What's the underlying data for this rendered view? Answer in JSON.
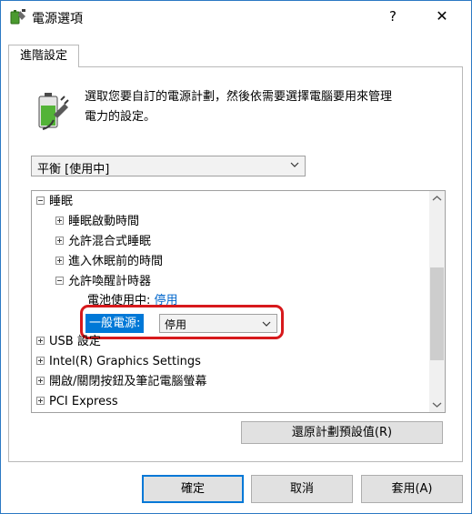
{
  "window": {
    "title": "電源選項",
    "help_label": "?",
    "close_label": "✕"
  },
  "tabs": [
    {
      "label": "進階設定",
      "selected": true
    }
  ],
  "description": {
    "line1": "選取您要自訂的電源計劃，然後依需要選擇電腦要用來管理",
    "line2": "電力的設定。"
  },
  "plan_select": {
    "value": "平衡 [使用中]"
  },
  "tree": {
    "items": [
      {
        "label": "睡眠",
        "expander": "minus"
      },
      {
        "label": "睡眠啟動時間",
        "expander": "plus"
      },
      {
        "label": "允許混合式睡眠",
        "expander": "plus"
      },
      {
        "label": "進入休眠前的時間",
        "expander": "plus"
      },
      {
        "label": "允許喚醒計時器",
        "expander": "minus"
      },
      {
        "label": "電池使用中:",
        "value": "停用"
      },
      {
        "label": "USB 設定",
        "expander": "plus"
      },
      {
        "label": "Intel(R) Graphics Settings",
        "expander": "plus"
      },
      {
        "label": "開啟/關閉按鈕及筆記電腦螢幕",
        "expander": "plus"
      },
      {
        "label": "PCI Express",
        "expander": "plus"
      }
    ],
    "selected_setting": {
      "label": "一般電源:",
      "value": "停用"
    }
  },
  "restore_button": "還原計劃預設值(R)",
  "buttons": {
    "ok": "確定",
    "cancel": "取消",
    "apply": "套用(A)"
  },
  "colors": {
    "accent": "#0078d7",
    "highlight_ring": "#d7191c",
    "link": "#0066cc"
  }
}
